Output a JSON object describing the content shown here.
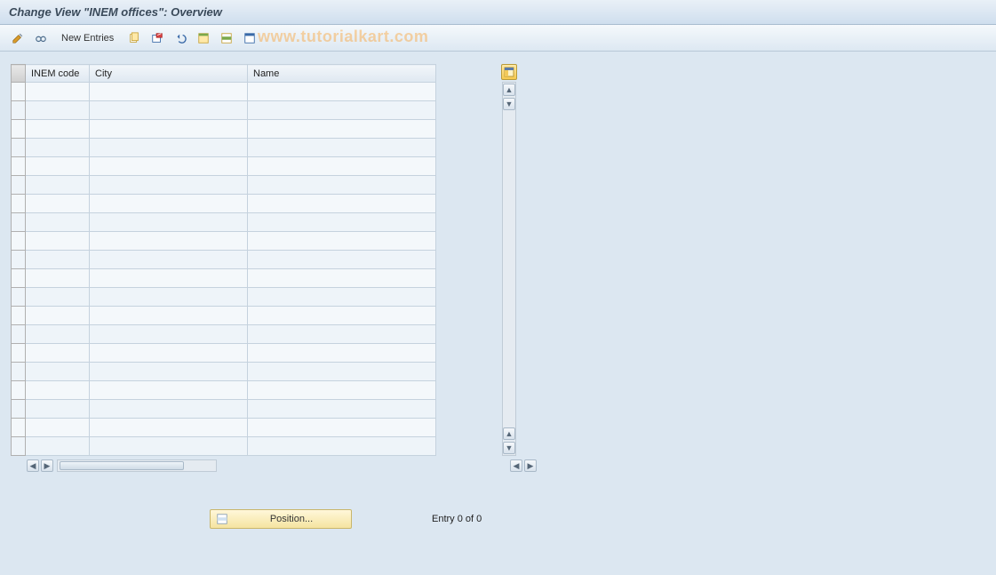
{
  "header": {
    "title": "Change View \"INEM offices\": Overview"
  },
  "toolbar": {
    "new_entries_label": "New Entries",
    "icons": {
      "toggle": "toggle-icon",
      "other": "glasses-icon",
      "copy": "copy-icon",
      "delete": "delete-icon",
      "undo": "undo-icon",
      "select_all": "select-all-icon",
      "select_block": "select-block-icon",
      "deselect": "deselect-icon"
    }
  },
  "watermark": "www.tutorialkart.com",
  "table": {
    "columns": [
      "INEM code",
      "City",
      "Name"
    ],
    "row_count": 20,
    "rows": []
  },
  "footer": {
    "position_label": "Position...",
    "entry_status": "Entry 0 of 0"
  }
}
